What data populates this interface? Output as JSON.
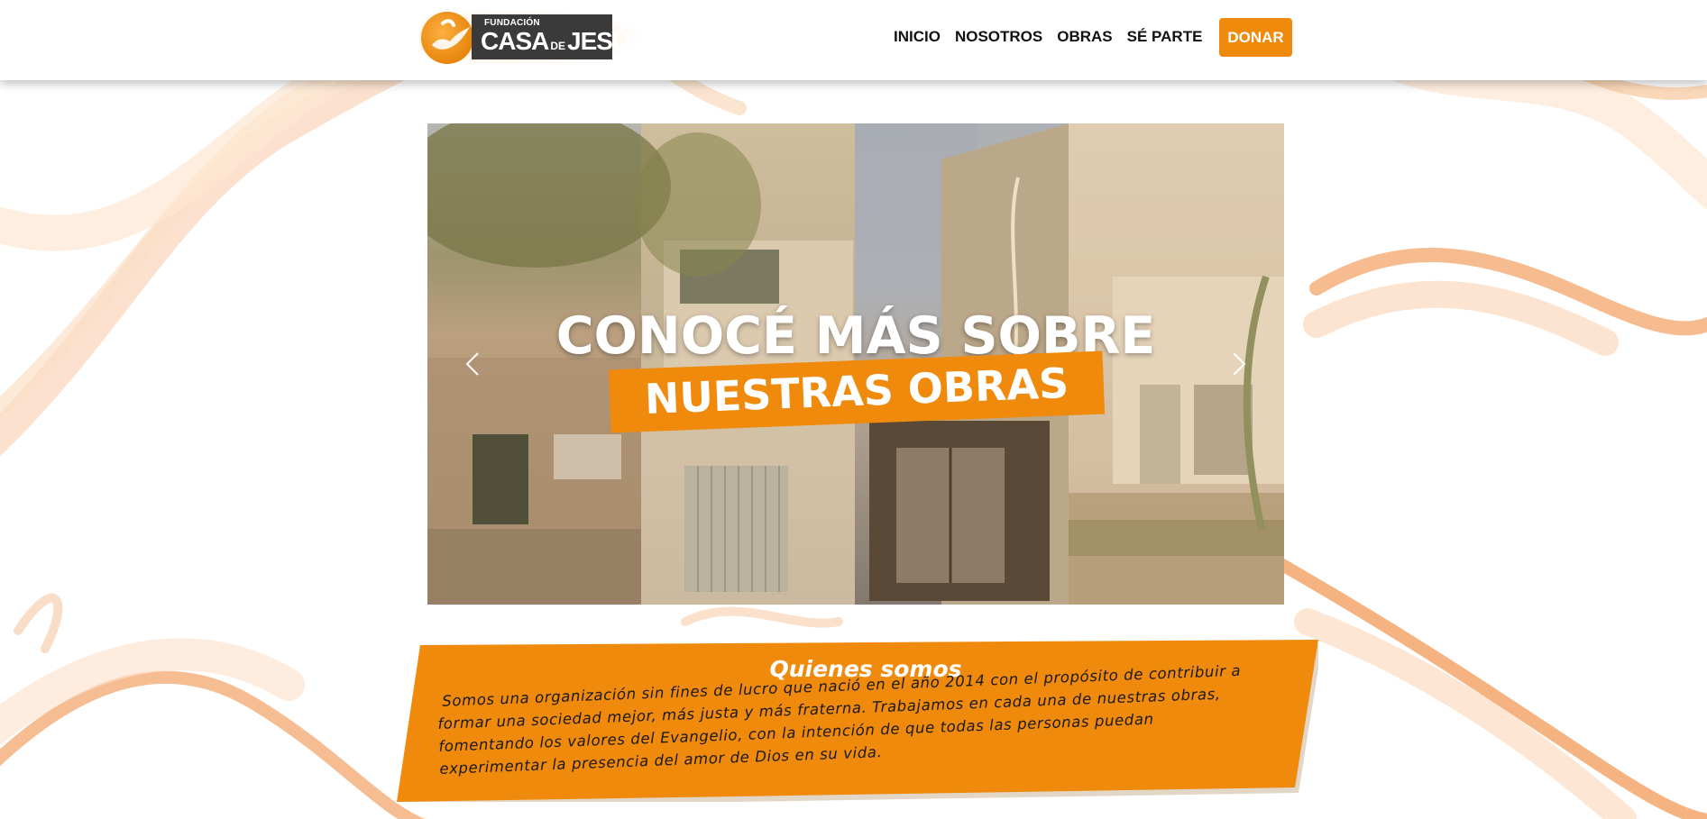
{
  "brand": {
    "name_small": "FUNDACIÓN",
    "name_part1": "CASA",
    "name_part2": "DE",
    "name_part3": "JESÚS"
  },
  "nav": {
    "items": [
      {
        "label": "INICIO"
      },
      {
        "label": "NOSOTROS"
      },
      {
        "label": "OBRAS"
      },
      {
        "label": "SÉ PARTE"
      }
    ],
    "donate_label": "DONAR"
  },
  "hero": {
    "line1": "CONOCÉ MÁS SOBRE",
    "line2": "NUESTRAS OBRAS",
    "prev_icon": "chevron-left-icon",
    "next_icon": "chevron-right-icon"
  },
  "about": {
    "title": "Quienes somos",
    "lines": [
      " Somos una organización sin fines de lucro que nació en el año 2014 con el propósito de contribuir a",
      "formar una sociedad mejor, más justa y más fraterna. Trabajamos en cada una de nuestras obras,",
      "fomentando los valores del Evangelio, con la intención de que todas las personas puedan",
      "experimentar la presencia del amor de Dios en su vida."
    ]
  },
  "colors": {
    "accent": "#f08a0c",
    "logo_box": "#3a3a3a",
    "text_dark": "#111111"
  }
}
